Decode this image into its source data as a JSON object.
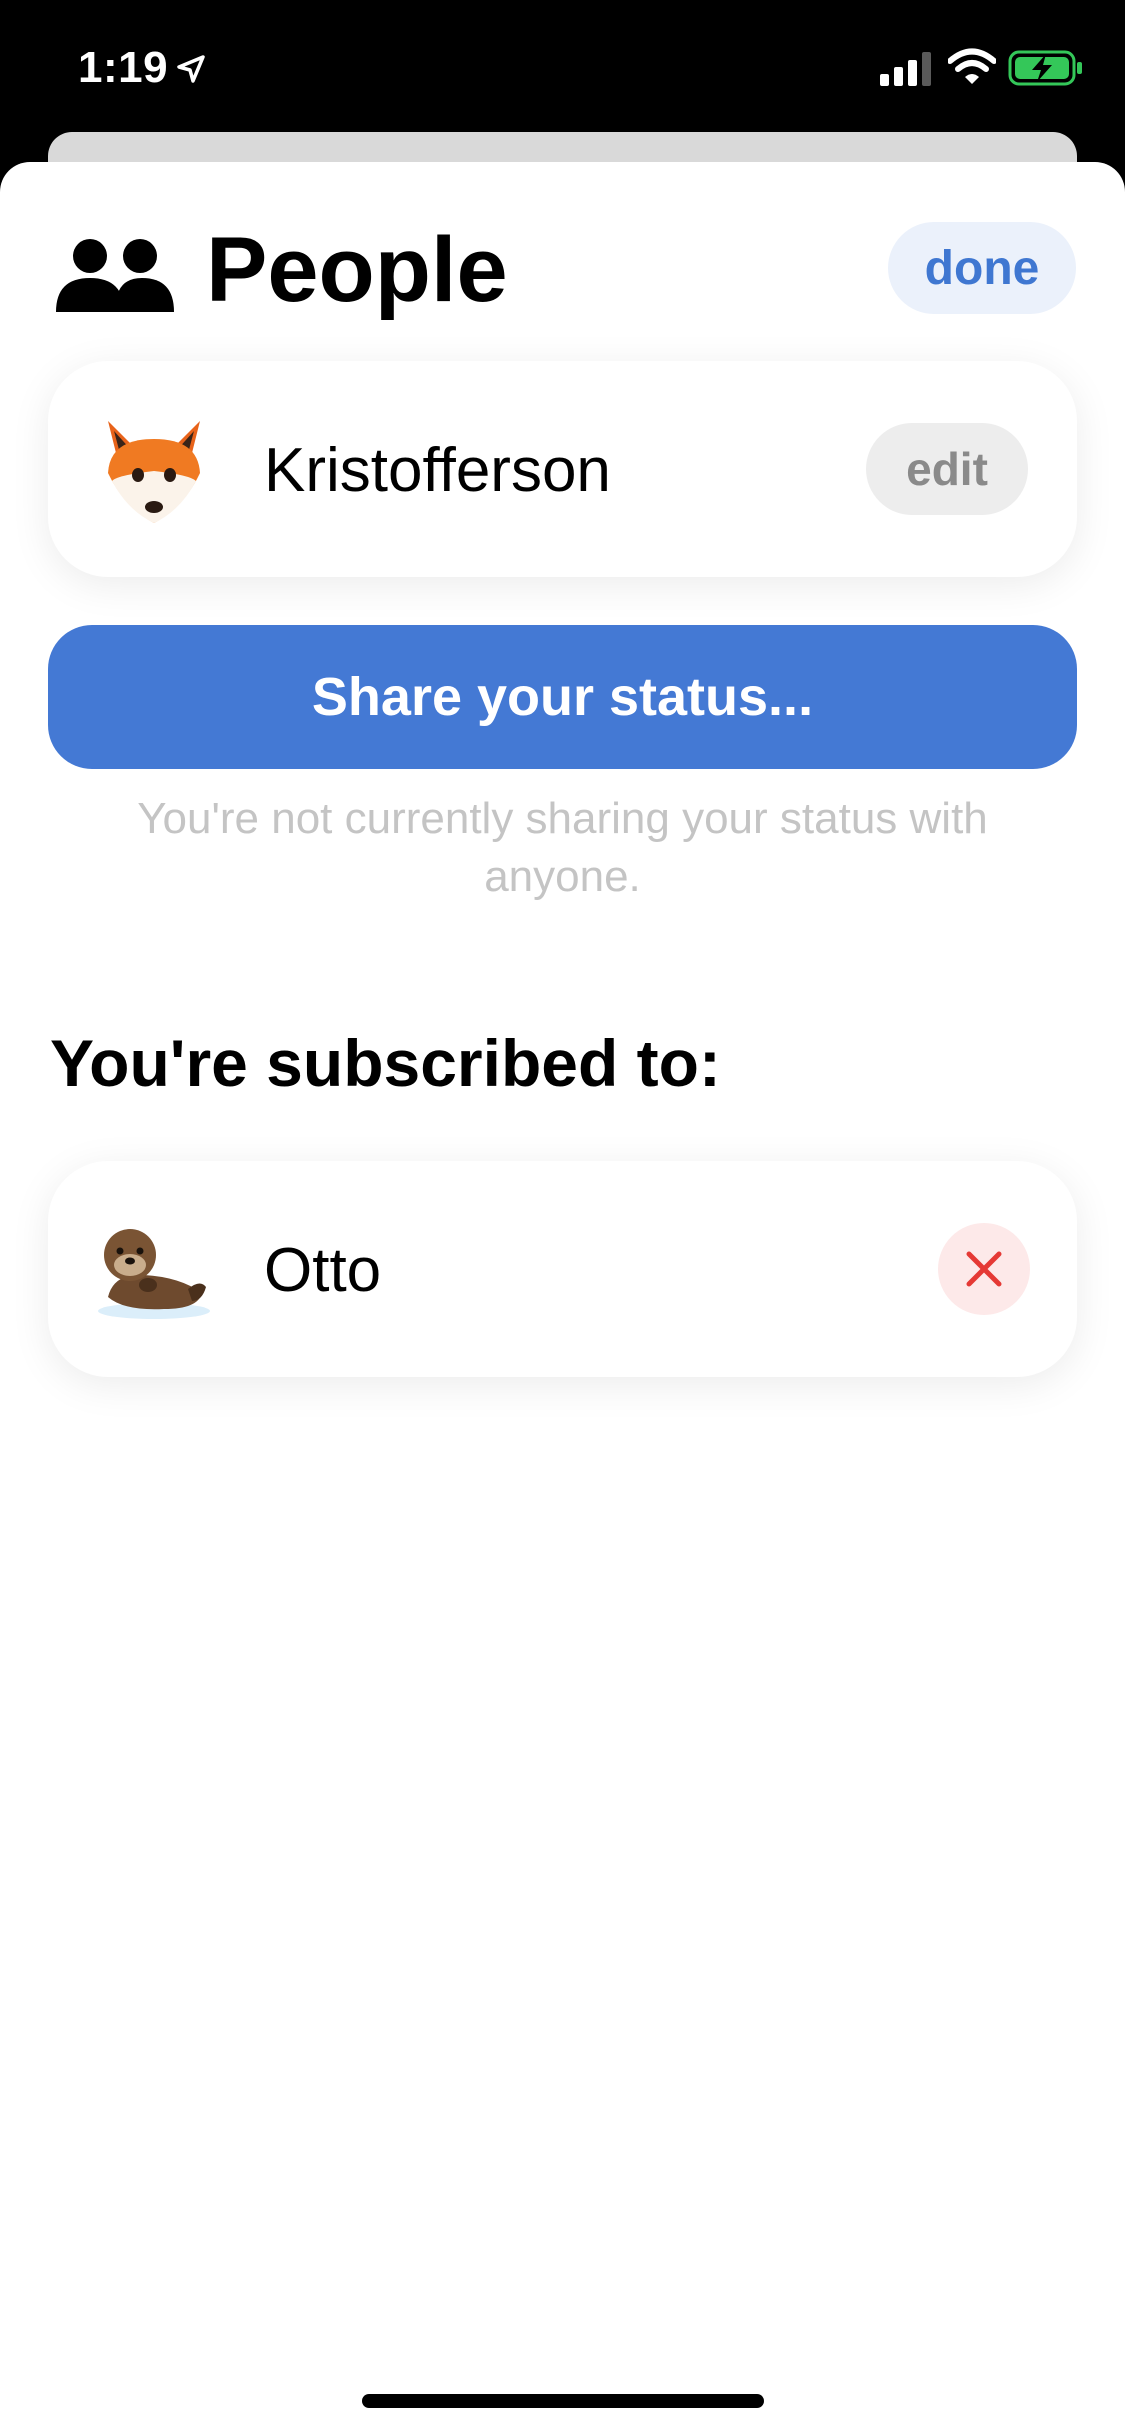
{
  "status_bar": {
    "time": "1:19",
    "icons": [
      "location-arrow-icon",
      "cellular-signal-icon",
      "wifi-icon",
      "battery-charging-icon"
    ],
    "battery_color": "#34c759"
  },
  "header": {
    "icon": "people-icon",
    "title": "People",
    "done_label": "done"
  },
  "my_profile": {
    "avatar": "fox-avatar",
    "name": "Kristofferson",
    "edit_label": "edit"
  },
  "share": {
    "button_label": "Share your status...",
    "note": "You're not currently sharing your status with anyone."
  },
  "subscriptions": {
    "heading": "You're subscribed to:",
    "items": [
      {
        "avatar": "otter-avatar",
        "name": "Otto",
        "remove_icon": "close-icon"
      }
    ]
  },
  "colors": {
    "accent": "#4479d4",
    "accent_text": "#3f77d1",
    "destructive": "#e53935"
  }
}
